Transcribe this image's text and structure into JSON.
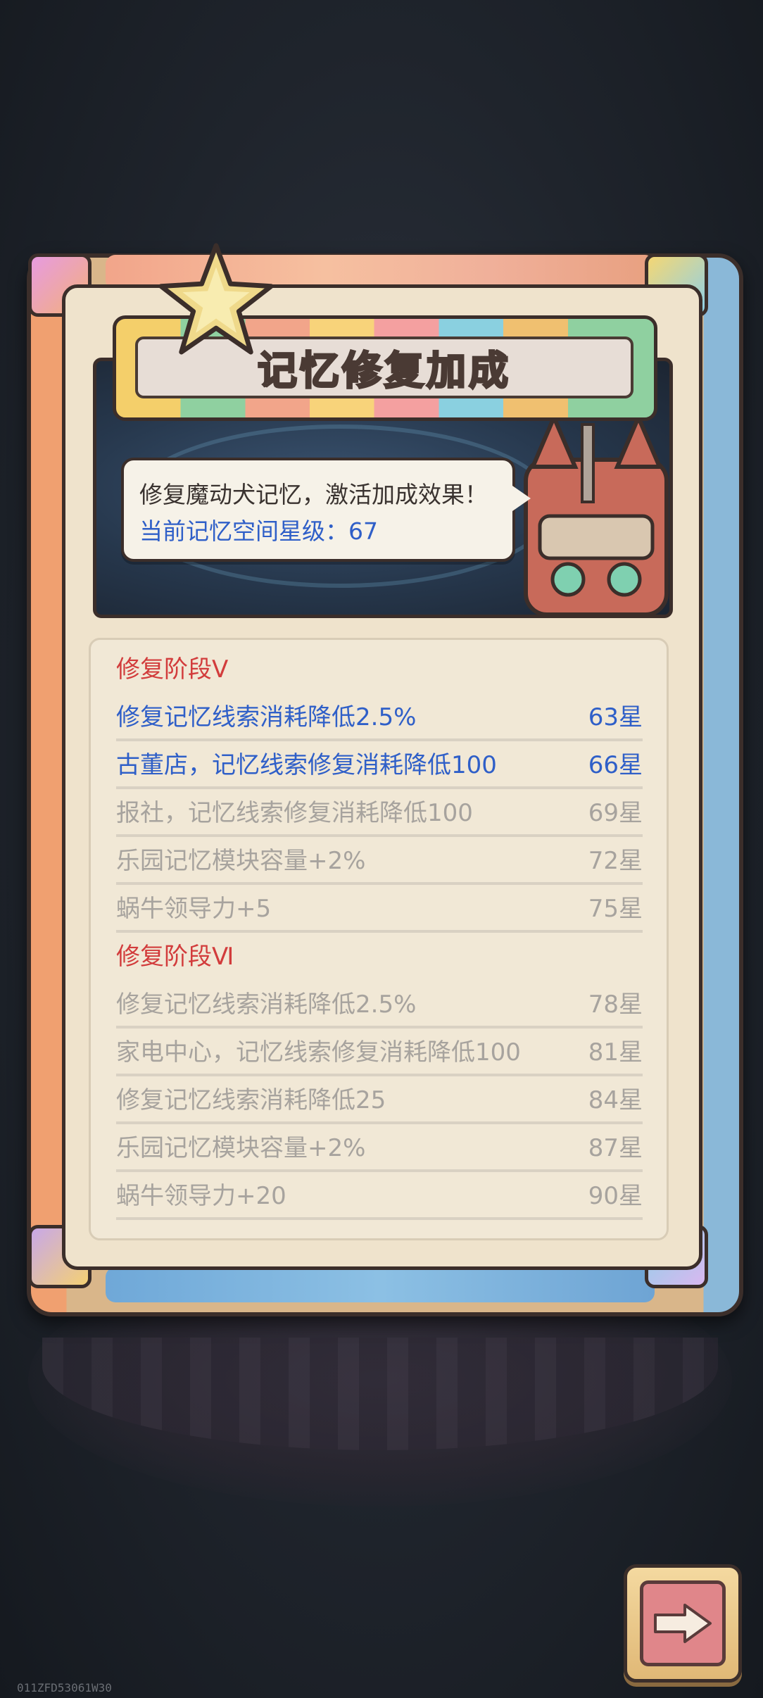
{
  "title": "记忆修复加成",
  "speech": {
    "line1": "修复魔动犬记忆，激活加成效果！",
    "line2": "当前记忆空间星级：67"
  },
  "rows": [
    {
      "label": "修复阶段Ⅴ",
      "value": "",
      "type": "stage"
    },
    {
      "label": "修复记忆线索消耗降低2.5%",
      "value": "63星",
      "type": "active"
    },
    {
      "label": "古董店，记忆线索修复消耗降低100",
      "value": "66星",
      "type": "active"
    },
    {
      "label": "报社，记忆线索修复消耗降低100",
      "value": "69星",
      "type": "inactive"
    },
    {
      "label": "乐园记忆模块容量+2%",
      "value": "72星",
      "type": "inactive"
    },
    {
      "label": "蜗牛领导力+5",
      "value": "75星",
      "type": "inactive"
    },
    {
      "label": "修复阶段Ⅵ",
      "value": "",
      "type": "stage"
    },
    {
      "label": "修复记忆线索消耗降低2.5%",
      "value": "78星",
      "type": "inactive"
    },
    {
      "label": "家电中心，记忆线索修复消耗降低100",
      "value": "81星",
      "type": "inactive"
    },
    {
      "label": "修复记忆线索消耗降低25",
      "value": "84星",
      "type": "inactive"
    },
    {
      "label": "乐园记忆模块容量+2%",
      "value": "87星",
      "type": "inactive"
    },
    {
      "label": "蜗牛领导力+20",
      "value": "90星",
      "type": "inactive"
    }
  ],
  "version": "011ZFD53061W30",
  "colors": {
    "active": "#2f5fc8",
    "inactive": "#a7a39e",
    "stage": "#d23c3c"
  },
  "icons": {
    "star": "star-icon",
    "mecha": "mecha-dog-icon",
    "next": "arrow-right-icon"
  }
}
